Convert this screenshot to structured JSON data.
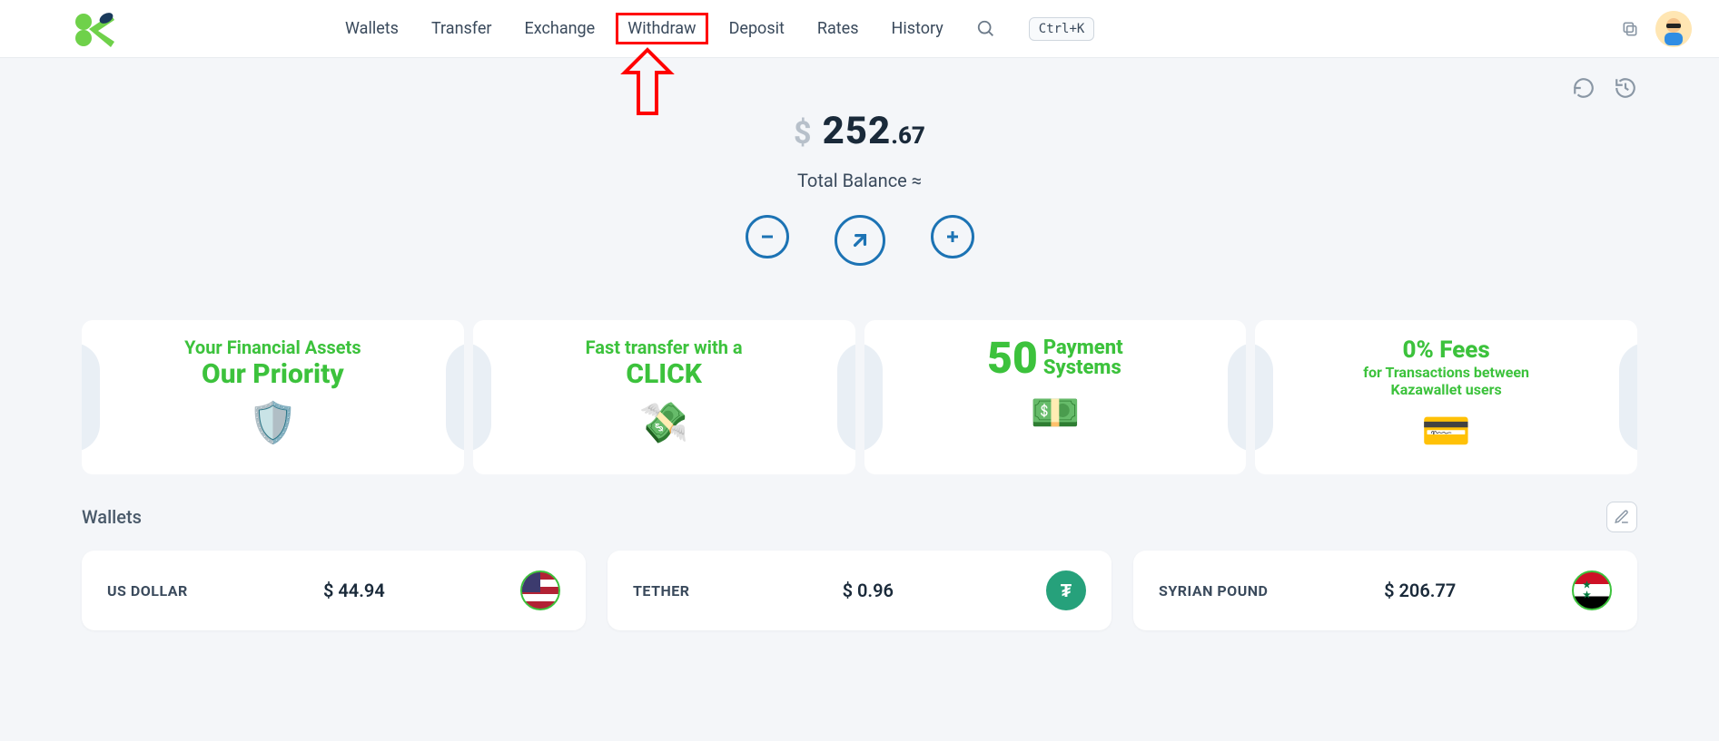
{
  "nav": {
    "items": [
      "Wallets",
      "Transfer",
      "Exchange",
      "Withdraw",
      "Deposit",
      "Rates",
      "History"
    ],
    "shortcut": "Ctrl+K"
  },
  "balance": {
    "currency_symbol": "$",
    "major": "252",
    "minor": ".67",
    "label": "Total Balance ≈"
  },
  "promos": [
    {
      "line1": "Your Financial Assets",
      "line2": "Our Priority"
    },
    {
      "line1": "Fast transfer with a",
      "line2": "CLICK"
    },
    {
      "big": "50",
      "col1": "Payment",
      "col2": "Systems"
    },
    {
      "line1": "0% Fees",
      "line2": "for Transactions between",
      "line3": "Kazawallet users"
    }
  ],
  "wallets": {
    "title": "Wallets",
    "items": [
      {
        "name": "US DOLLAR",
        "amount": "$ 44.94",
        "flag": "us"
      },
      {
        "name": "TETHER",
        "amount": "$ 0.96",
        "flag": "tether",
        "symbol": "₮"
      },
      {
        "name": "SYRIAN POUND",
        "amount": "$ 206.77",
        "flag": "syp"
      }
    ]
  }
}
